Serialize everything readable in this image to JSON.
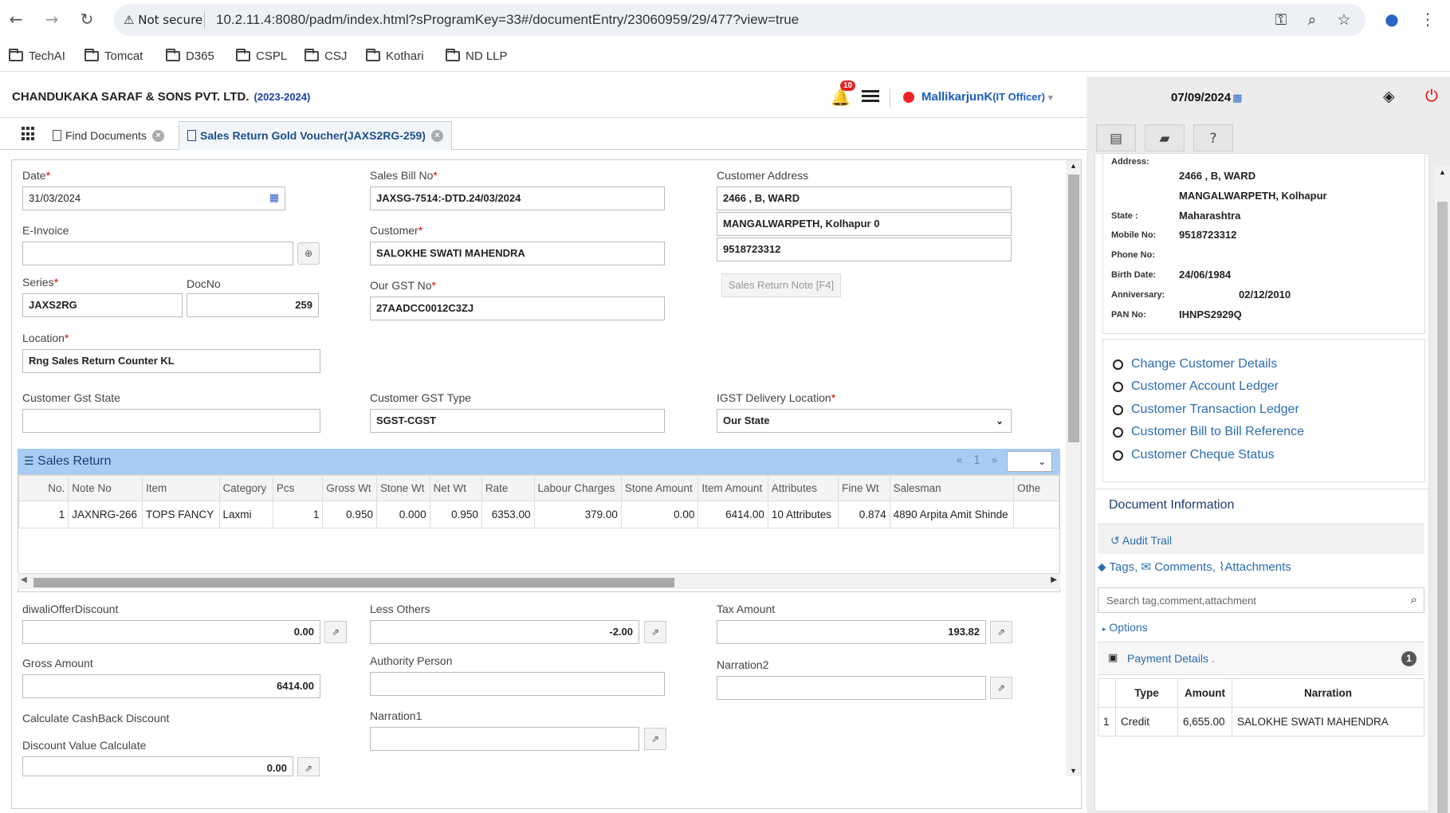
{
  "browser": {
    "security": "Not secure",
    "url": "10.2.11.4:8080/padm/index.html?sProgramKey=33#/documentEntry/23060959/29/477?view=true"
  },
  "bookmarks": [
    "TechAI",
    "Tomcat",
    "D365",
    "CSPL",
    "CSJ",
    "Kothari",
    "ND LLP"
  ],
  "header": {
    "company": "CHANDUKAKA SARAF & SONS PVT. LTD.",
    "fy": "(2023-2024)",
    "notifications": "10",
    "user": "MallikarjunK",
    "role": "(IT Officer)",
    "date": "07/09/2024"
  },
  "tabs": {
    "find": "Find Documents",
    "voucher": "Sales Return Gold Voucher(JAXS2RG-259)"
  },
  "form": {
    "date_label": "Date",
    "date": "31/03/2024",
    "bill_label": "Sales Bill No",
    "bill": "JAXSG-7514:-DTD.24/03/2024",
    "address_label": "Customer Address",
    "addr1": "2466 , B, WARD",
    "addr2": "MANGALWARPETH, Kolhapur 0",
    "addr3": "9518723312",
    "einvoice_label": "E-Invoice",
    "customer_label": "Customer",
    "customer": "SALOKHE SWATI MAHENDRA",
    "series_label": "Series",
    "series": "JAXS2RG",
    "docno_label": "DocNo",
    "docno": "259",
    "gst_label": "Our GST No",
    "gst": "27AADCC0012C3ZJ",
    "return_note_btn": "Sales Return Note [F4]",
    "location_label": "Location",
    "location": "Rng Sales Return Counter KL",
    "gst_state_label": "Customer Gst State",
    "gst_type_label": "Customer GST Type",
    "gst_type": "SGST-CGST",
    "igst_label": "IGST Delivery Location",
    "igst": "Our State",
    "diwali_label": "diwaliOfferDiscount",
    "diwali": "0.00",
    "less_label": "Less Others",
    "less": "-2.00",
    "tax_label": "Tax Amount",
    "tax": "193.82",
    "gross_label": "Gross Amount",
    "gross": "6414.00",
    "authority_label": "Authority Person",
    "narr2_label": "Narration2",
    "cashback_label": "Calculate CashBack Discount",
    "narr1_label": "Narration1",
    "discval_label": "Discount Value Calculate",
    "discval": "0.00"
  },
  "grid": {
    "title": "Sales Return",
    "page": "1",
    "columns": [
      "No.",
      "Note No",
      "Item",
      "Category",
      "Pcs",
      "Gross Wt",
      "Stone Wt",
      "Net Wt",
      "Rate",
      "Labour Charges",
      "Stone Amount",
      "Item Amount",
      "Attributes",
      "Fine Wt",
      "Salesman",
      "Othe"
    ],
    "rows": [
      [
        "1",
        "JAXNRG-266",
        "TOPS FANCY",
        "Laxmi",
        "1",
        "0.950",
        "0.000",
        "0.950",
        "6353.00",
        "379.00",
        "0.00",
        "6414.00",
        "10 Attributes",
        "0.874",
        "4890 Arpita Amit Shinde",
        ""
      ]
    ]
  },
  "customer_card": {
    "address_k": "Address:",
    "address1": "2466 , B, WARD",
    "address2": "MANGALWARPETH, Kolhapur",
    "state_k": "State :",
    "state": "Maharashtra",
    "mobile_k": "Mobile No:",
    "mobile": "9518723312",
    "phone_k": "Phone No:",
    "birth_k": "Birth Date:",
    "birth": "24/06/1984",
    "anniv_k": "Anniversary:",
    "anniv": "02/12/2010",
    "pan_k": "PAN No:",
    "pan": "IHNPS2929Q"
  },
  "links": [
    "Change Customer Details",
    "Customer Account Ledger",
    "Customer Transaction Ledger",
    "Customer Bill to Bill Reference",
    "Customer Cheque Status"
  ],
  "docinfo": {
    "title": "Document Information",
    "audit": "Audit Trail",
    "tags": "Tags,",
    "comments": "Comments,",
    "attachments": "Attachments",
    "search_ph": "Search tag,comment,attachment",
    "options": "Options"
  },
  "payment": {
    "title": "Payment Details .",
    "count": "1",
    "headers": [
      "Type",
      "Amount",
      "Narration"
    ],
    "row": [
      "1",
      "Credit",
      "6,655.00",
      "SALOKHE SWATI MAHENDRA"
    ]
  }
}
